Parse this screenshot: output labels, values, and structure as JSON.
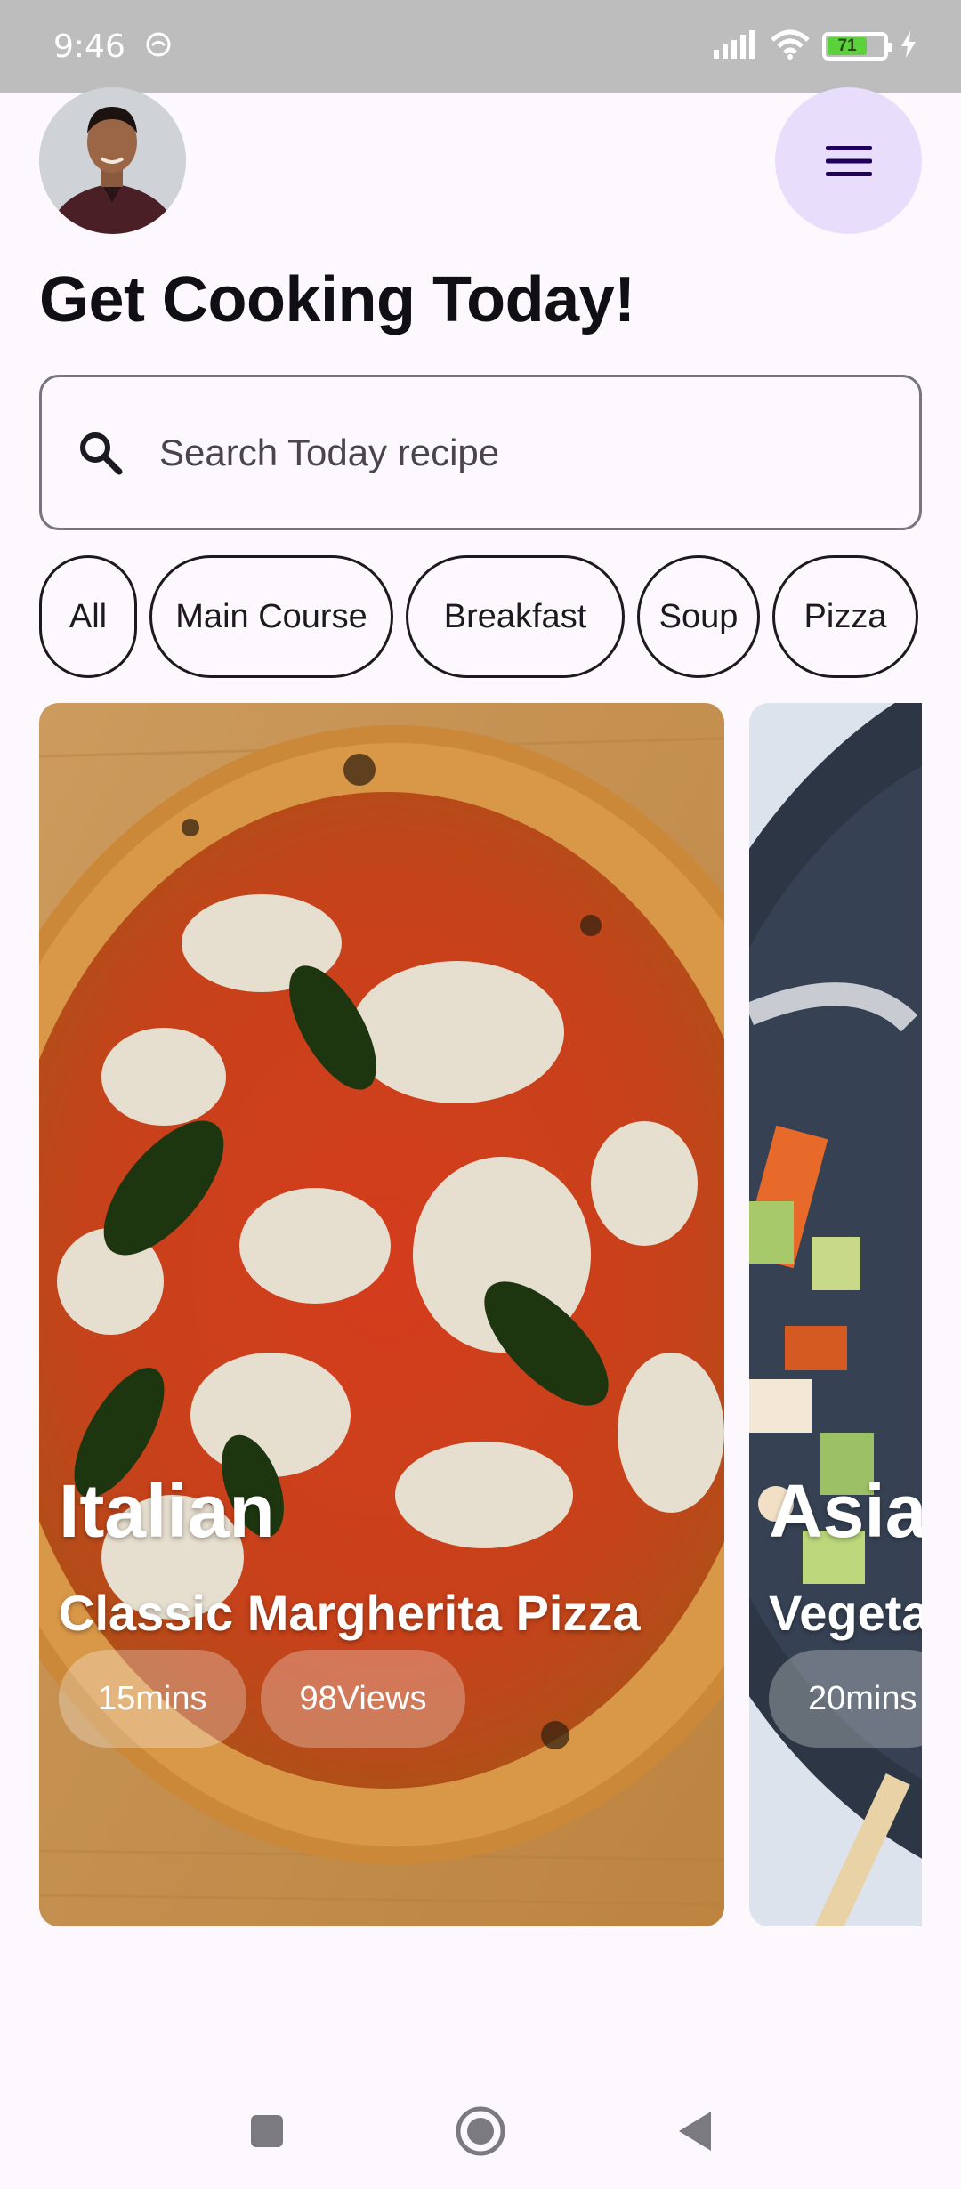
{
  "status_bar": {
    "time": "9:46",
    "battery_level": "71",
    "battery_fraction": 0.71
  },
  "header": {
    "title": "Get Cooking Today!",
    "menu_icon": "hamburger-menu-icon"
  },
  "search": {
    "placeholder": "Search Today recipe",
    "value": ""
  },
  "categories": [
    "All",
    "Main Course",
    "Breakfast",
    "Soup",
    "Pizza"
  ],
  "recipes": [
    {
      "cuisine": "Italian",
      "name": "Classic Margherita Pizza",
      "time": "15mins",
      "views": "98Views"
    },
    {
      "cuisine": "Asia",
      "name": "Vegeta",
      "time": "20mins",
      "views": ""
    }
  ],
  "colors": {
    "background": "#fdf8fd",
    "menu_button": "#e8ddfb",
    "menu_icon": "#21005d",
    "status_bar": "#bdbdbd",
    "battery": "#5bd23b"
  }
}
